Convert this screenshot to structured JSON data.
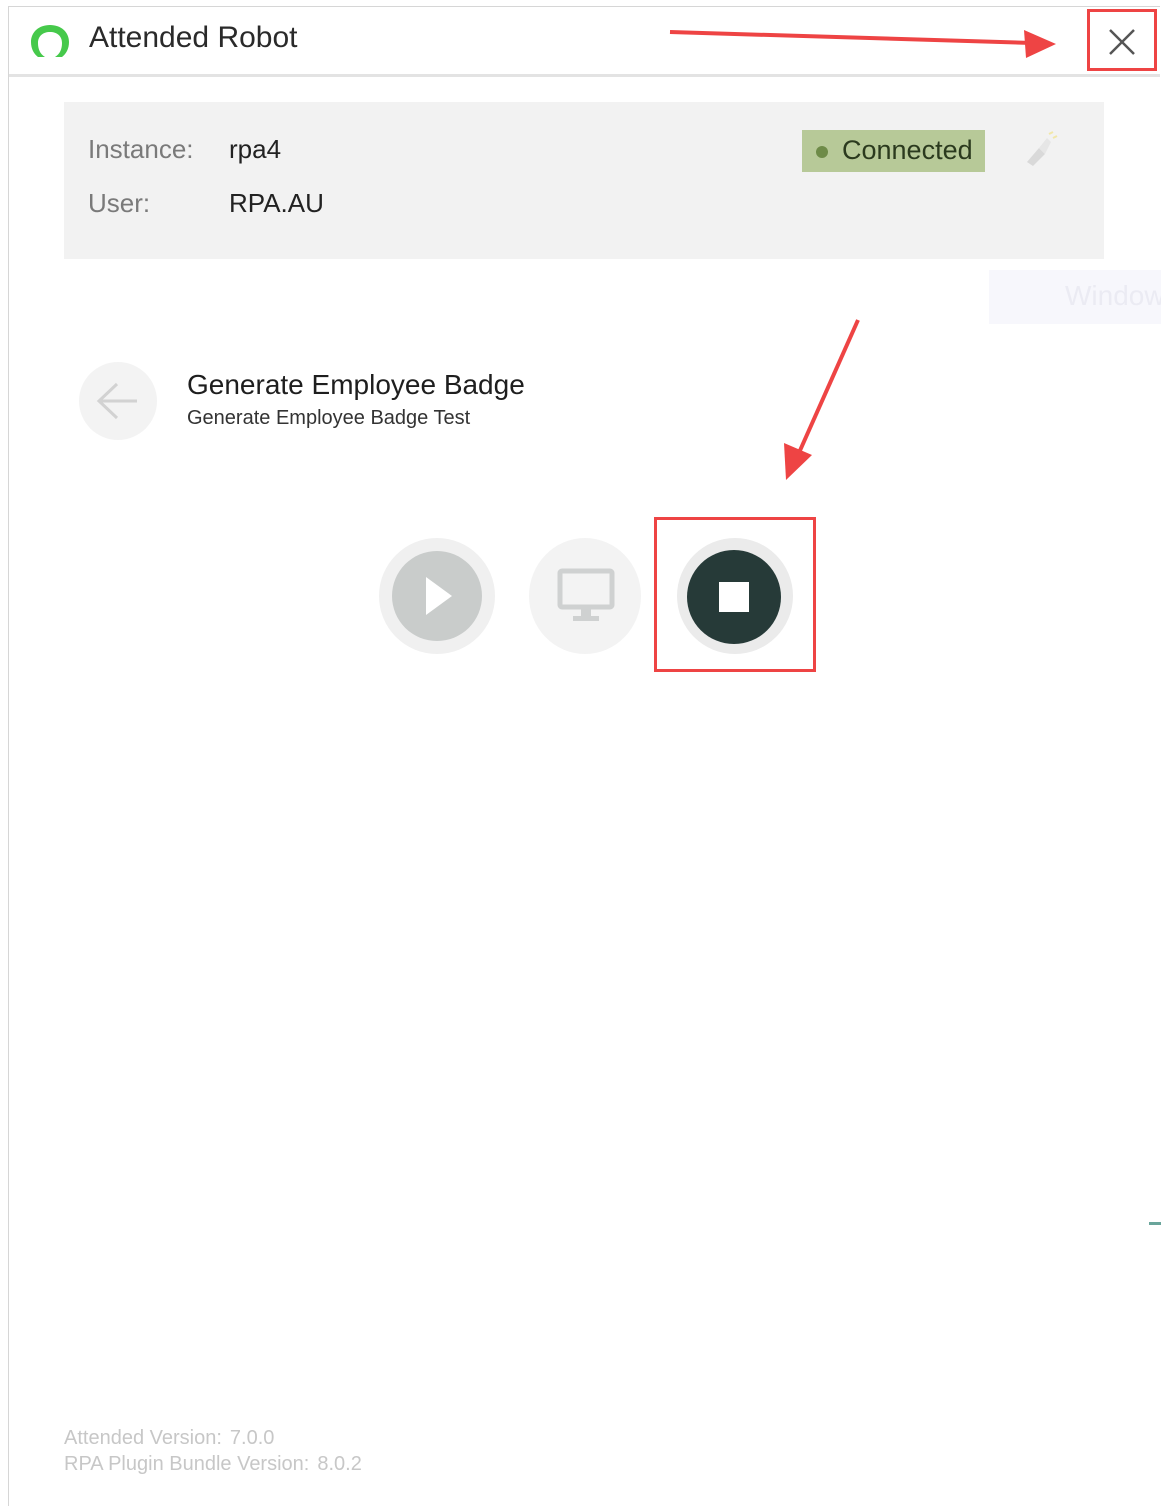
{
  "window": {
    "title": "Attended Robot",
    "logo_color": "#46c94b"
  },
  "info": {
    "instance_label": "Instance:",
    "instance_value": "rpa4",
    "user_label": "User:",
    "user_value": "RPA.AU",
    "status": "Connected",
    "status_color": "#b7c998"
  },
  "job": {
    "title": "Generate Employee Badge",
    "subtitle": "Generate Employee Badge Test"
  },
  "footer": {
    "attended_version_label": "Attended Version:",
    "attended_version_value": "7.0.0",
    "bundle_version_label": "RPA Plugin Bundle Version:",
    "bundle_version_value": "8.0.2"
  },
  "watermark": "Window",
  "annotation_color": "#ee4444"
}
